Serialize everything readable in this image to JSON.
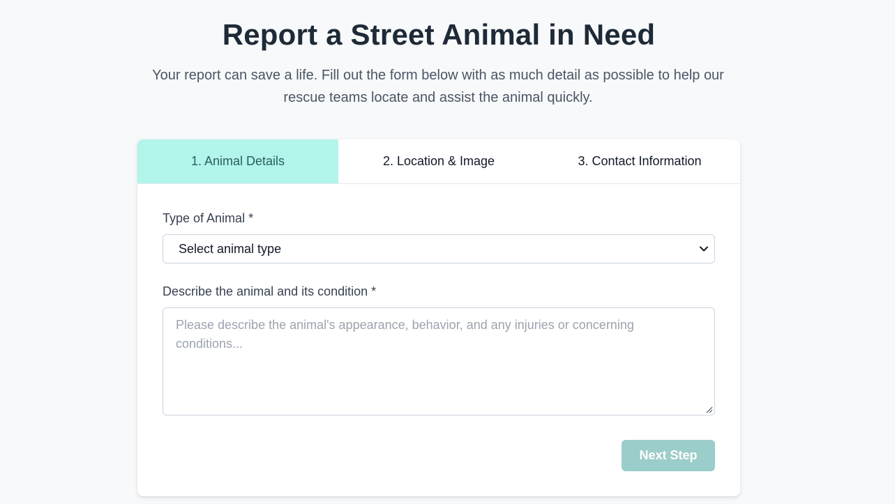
{
  "header": {
    "title": "Report a Street Animal in Need",
    "subtitle": "Your report can save a life. Fill out the form below with as much detail as possible to help our rescue teams locate and assist the animal quickly."
  },
  "tabs": [
    {
      "label": "1. Animal Details",
      "active": true
    },
    {
      "label": "2. Location & Image",
      "active": false
    },
    {
      "label": "3. Contact Information",
      "active": false
    }
  ],
  "form": {
    "animal_type": {
      "label": "Type of Animal *",
      "value": "Select animal type",
      "icon": "chevron-down-icon"
    },
    "description": {
      "label": "Describe the animal and its condition *",
      "placeholder": "Please describe the animal's appearance, behavior, and any injuries or concerning conditions..."
    },
    "next_label": "Next Step"
  },
  "colors": {
    "active_tab_bg": "#b2f5ea",
    "active_tab_text": "#285e61",
    "button_bg": "#9bcdca",
    "page_bg": "#f7f9fb"
  }
}
